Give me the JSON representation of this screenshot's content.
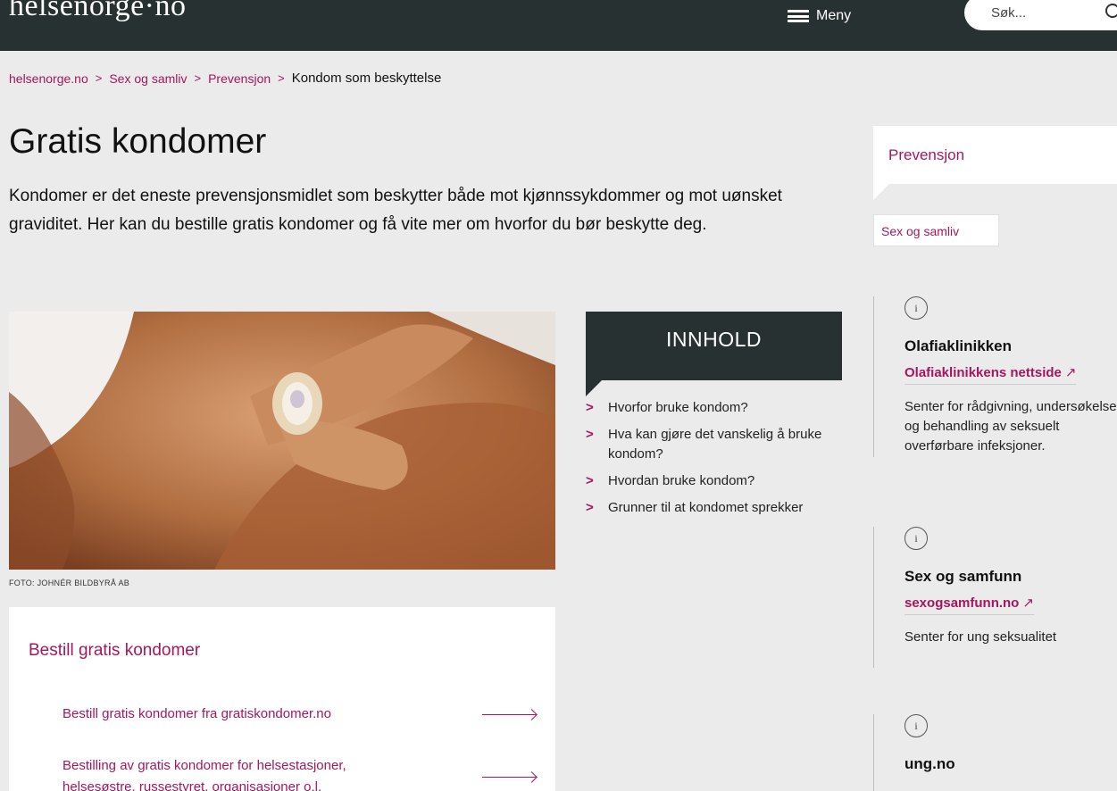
{
  "header": {
    "logo": "helsenorge·no",
    "menu_label": "Meny",
    "search_placeholder": "Søk..."
  },
  "breadcrumb": {
    "items": [
      "helsenorge.no",
      "Sex og samliv",
      "Prevensjon"
    ],
    "separator": ">",
    "current": "Kondom som beskyttelse"
  },
  "article": {
    "title": "Gratis kondomer",
    "ingress": "Kondomer er det eneste prevensjonsmidlet som beskytter både mot kjønnssykdommer og mot uønsket graviditet. Her kan du bestille gratis kondomer og få vite mer om hvorfor du bør beskytte deg.",
    "photo_caption": "FOTO: JOHNÉR BILDBYRÅ AB"
  },
  "order": {
    "heading": "Bestill gratis kondomer",
    "links": [
      "Bestill gratis kondomer fra gratiskondomer.no",
      "Bestilling av gratis kondomer for helsestasjoner, helsesøstre, russestyret, organisasjoner o.l."
    ]
  },
  "toc": {
    "heading": "INNHOLD",
    "items": [
      "Hvorfor bruke kondom?",
      "Hva kan gjøre det vanskelig å bruke kondom?",
      "Hvordan bruke kondom?",
      "Grunner til at kondomet sprekker"
    ]
  },
  "sidebar": {
    "tab": "Prevensjon",
    "chip": "Sex og samliv",
    "cards": [
      {
        "icon": "i",
        "title": "Olafiaklinikken",
        "link": "Olafiaklinikkens nettside",
        "link_icon": "↗",
        "text": "Senter for rådgivning, undersøkelse og behandling av seksuelt overførbare infeksjoner."
      },
      {
        "icon": "i",
        "title": "Sex og samfunn",
        "link": "sexogsamfunn.no",
        "link_icon": "↗",
        "text": "Senter for ung seksualitet"
      },
      {
        "icon": "i",
        "title": "ung.no"
      }
    ]
  },
  "colors": {
    "header_bg": "#283132",
    "accent": "#a4175f",
    "page_bg": "#ebebeb"
  }
}
